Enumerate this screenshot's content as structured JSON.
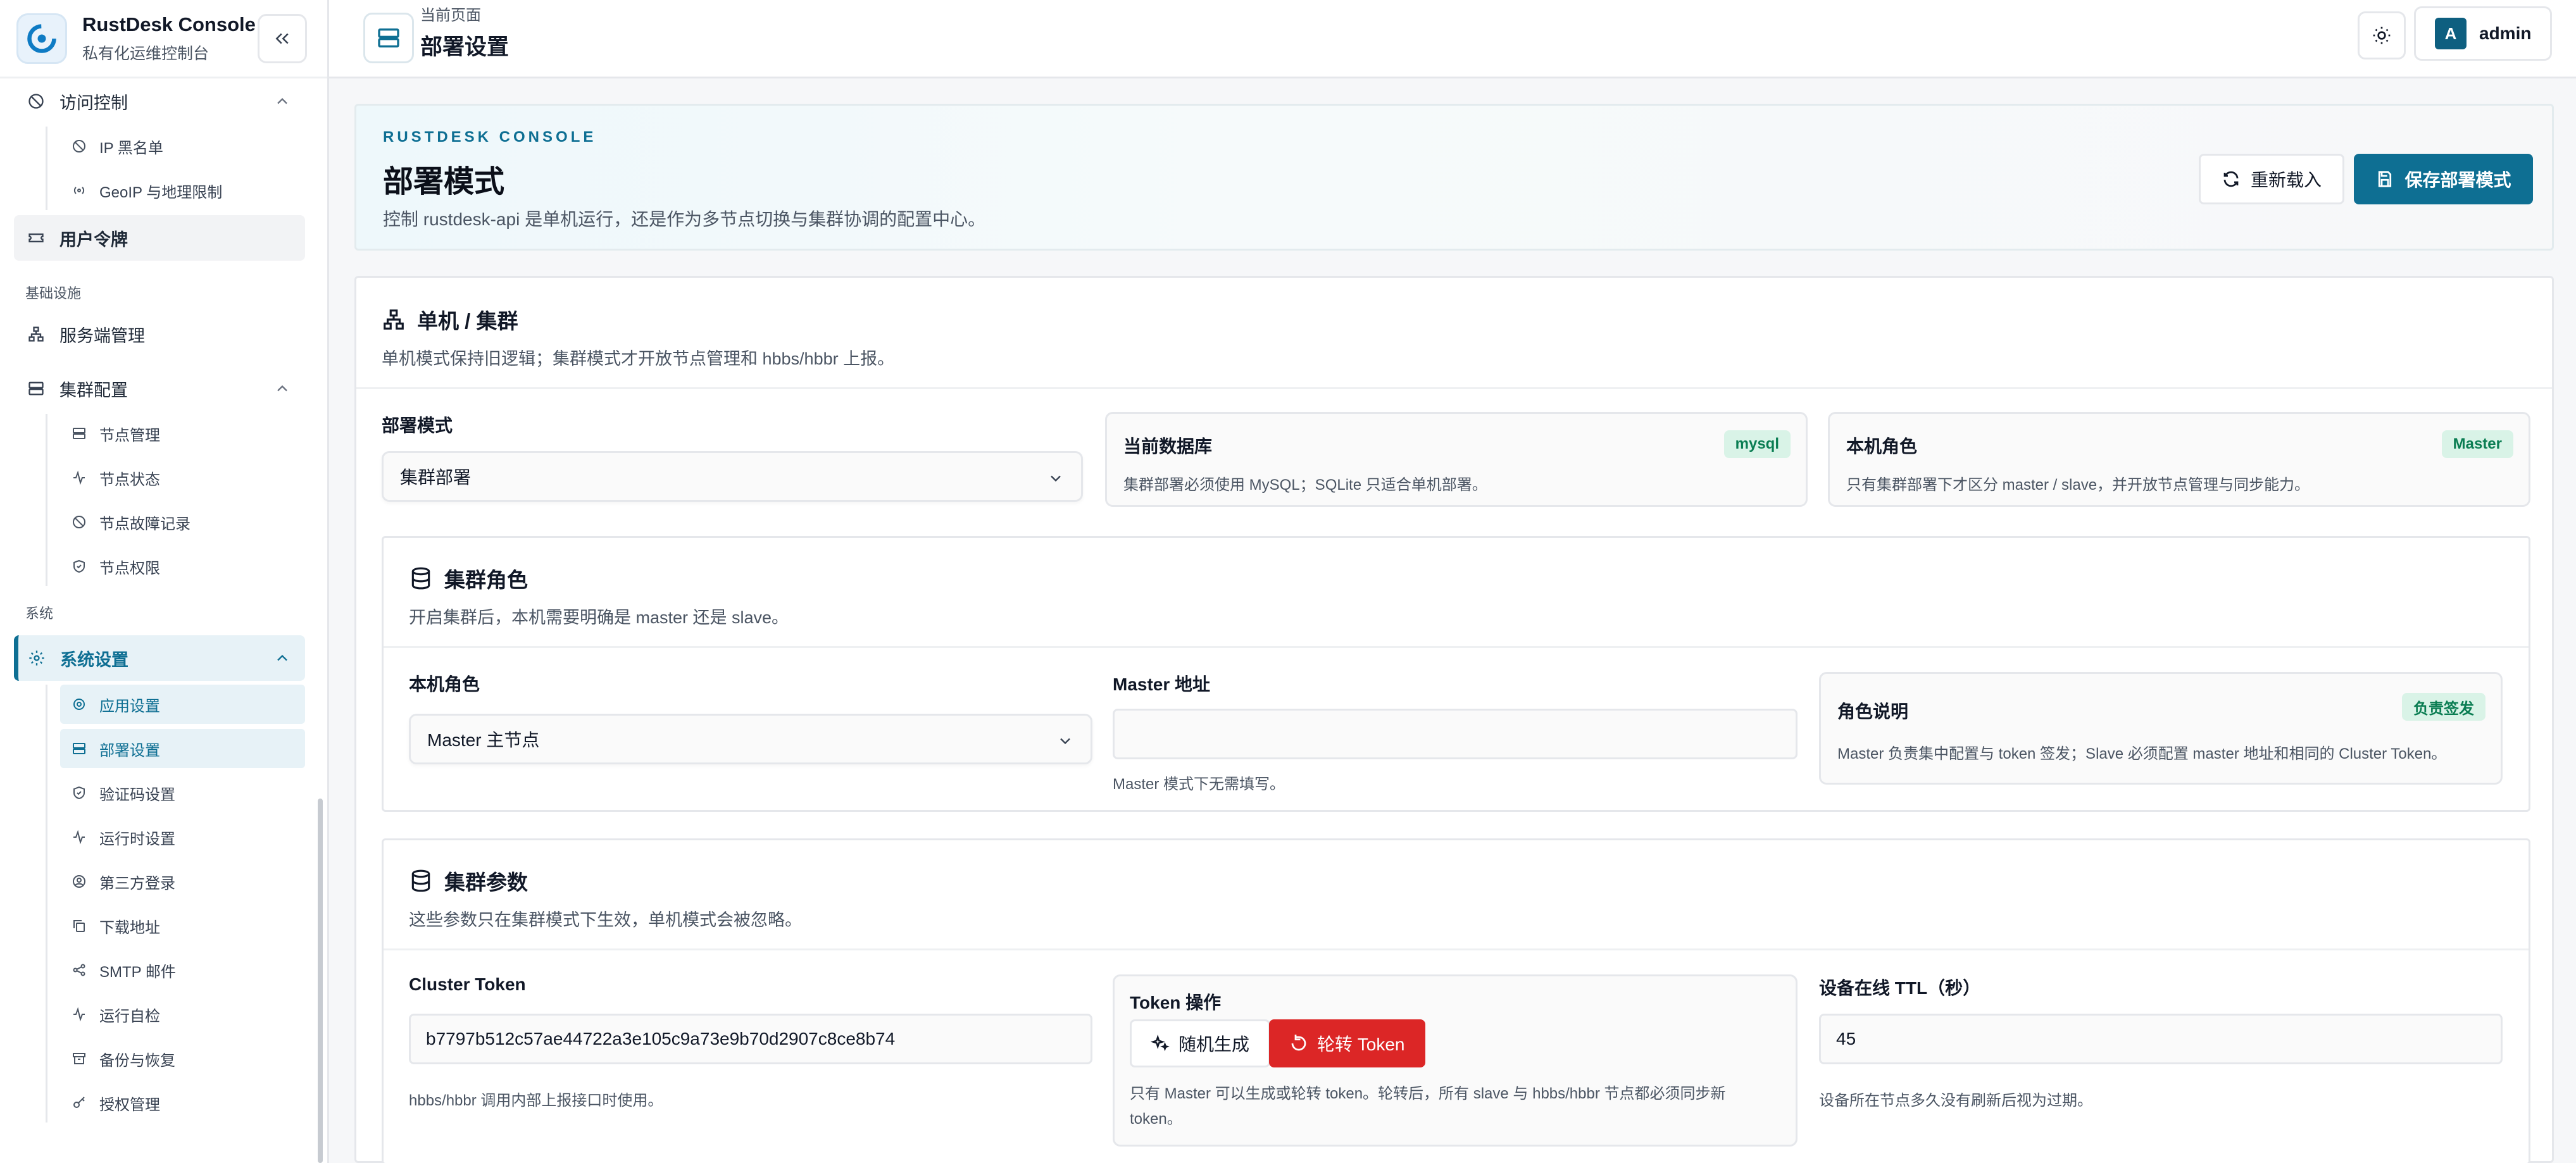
{
  "brand": {
    "title": "RustDesk Console",
    "subtitle": "私有化运维控制台"
  },
  "sidebar": {
    "access_control": "访问控制",
    "access_items": [
      "IP 黑名单",
      "GeoIP 与地理限制"
    ],
    "user_token": "用户令牌",
    "section_infra": "基础设施",
    "server_mgmt": "服务端管理",
    "cluster_config": "集群配置",
    "cluster_items": [
      "节点管理",
      "节点状态",
      "节点故障记录",
      "节点权限"
    ],
    "section_system": "系统",
    "system_settings": "系统设置",
    "system_items": [
      "应用设置",
      "部署设置",
      "验证码设置",
      "运行时设置",
      "第三方登录",
      "下载地址",
      "SMTP 邮件",
      "运行自检",
      "备份与恢复",
      "授权管理"
    ]
  },
  "topbar": {
    "crumb_small": "当前页面",
    "crumb_title": "部署设置",
    "user_initial": "A",
    "user_name": "admin"
  },
  "hero": {
    "eyebrow": "RUSTDESK CONSOLE",
    "title": "部署模式",
    "desc": "控制 rustdesk-api 是单机运行，还是作为多节点切换与集群协调的配置中心。",
    "reload": "重新载入",
    "save": "保存部署模式"
  },
  "mode_section": {
    "title": "单机 / 集群",
    "desc": "单机模式保持旧逻辑；集群模式才开放节点管理和 hbbs/hbbr 上报。",
    "deploy_label": "部署模式",
    "deploy_value": "集群部署",
    "db_title": "当前数据库",
    "db_badge": "mysql",
    "db_text": "集群部署必须使用 MySQL；SQLite 只适合单机部署。",
    "role_title": "本机角色",
    "role_badge": "Master",
    "role_text": "只有集群部署下才区分 master / slave，并开放节点管理与同步能力。"
  },
  "role_section": {
    "title": "集群角色",
    "desc": "开启集群后，本机需要明确是 master 还是 slave。",
    "role_label": "本机角色",
    "role_value": "Master 主节点",
    "master_label": "Master 地址",
    "master_value": "",
    "master_help": "Master 模式下无需填写。",
    "explain_title": "角色说明",
    "explain_badge": "负责签发",
    "explain_text": "Master 负责集中配置与 token 签发；Slave 必须配置 master 地址和相同的 Cluster Token。"
  },
  "params_section": {
    "title": "集群参数",
    "desc": "这些参数只在集群模式下生效，单机模式会被忽略。",
    "token_label": "Cluster Token",
    "token_value": "b7797b512c57ae44722a3e105c9a73e9b70d2907c8ce8b74",
    "token_help": "hbbs/hbbr 调用内部上报接口时使用。",
    "ops_title": "Token 操作",
    "gen_btn": "随机生成",
    "rotate_btn": "轮转 Token",
    "ops_help_1": "只有 Master 可以生成或轮转 token。轮转后，所有 slave 与 hbbs/hbbr 节点都必须同步新",
    "ops_help_2": "token。",
    "ttl_label": "设备在线 TTL（秒）",
    "ttl_value": "45",
    "ttl_help": "设备所在节点多久没有刷新后视为过期。"
  },
  "colors": {
    "accent": "#0e6f93",
    "danger": "#dc2626",
    "badge_bg": "#d9f3e7",
    "badge_text": "#0a7d52"
  }
}
